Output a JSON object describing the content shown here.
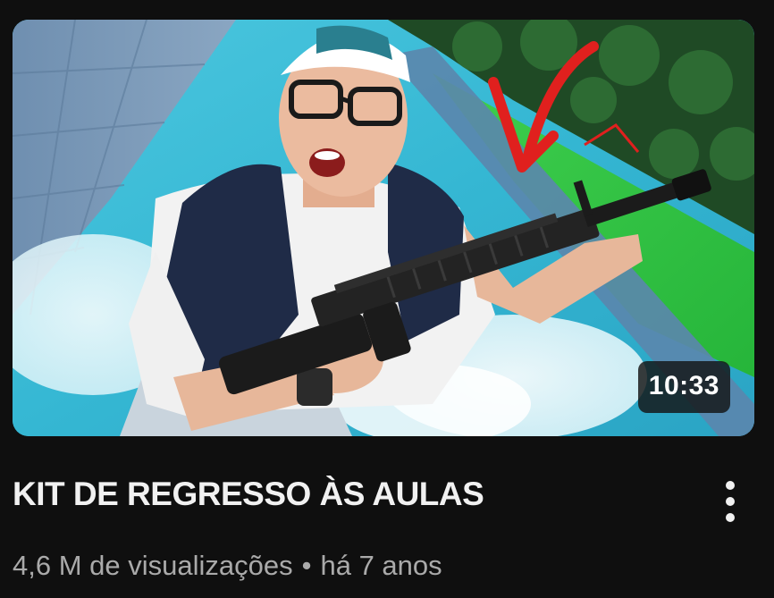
{
  "video": {
    "title": "KIT DE REGRESSO ÀS AULAS",
    "duration": "10:33",
    "views": "4,6 M de visualizações",
    "separator": "•",
    "age": "há 7 anos"
  },
  "icons": {
    "menu": "more-vertical-icon"
  },
  "colors": {
    "background": "#0f0f0f",
    "title_text": "#f1f1f1",
    "meta_text": "#aaaaaa",
    "duration_badge": "#141414",
    "arrow": "#e0201e"
  }
}
